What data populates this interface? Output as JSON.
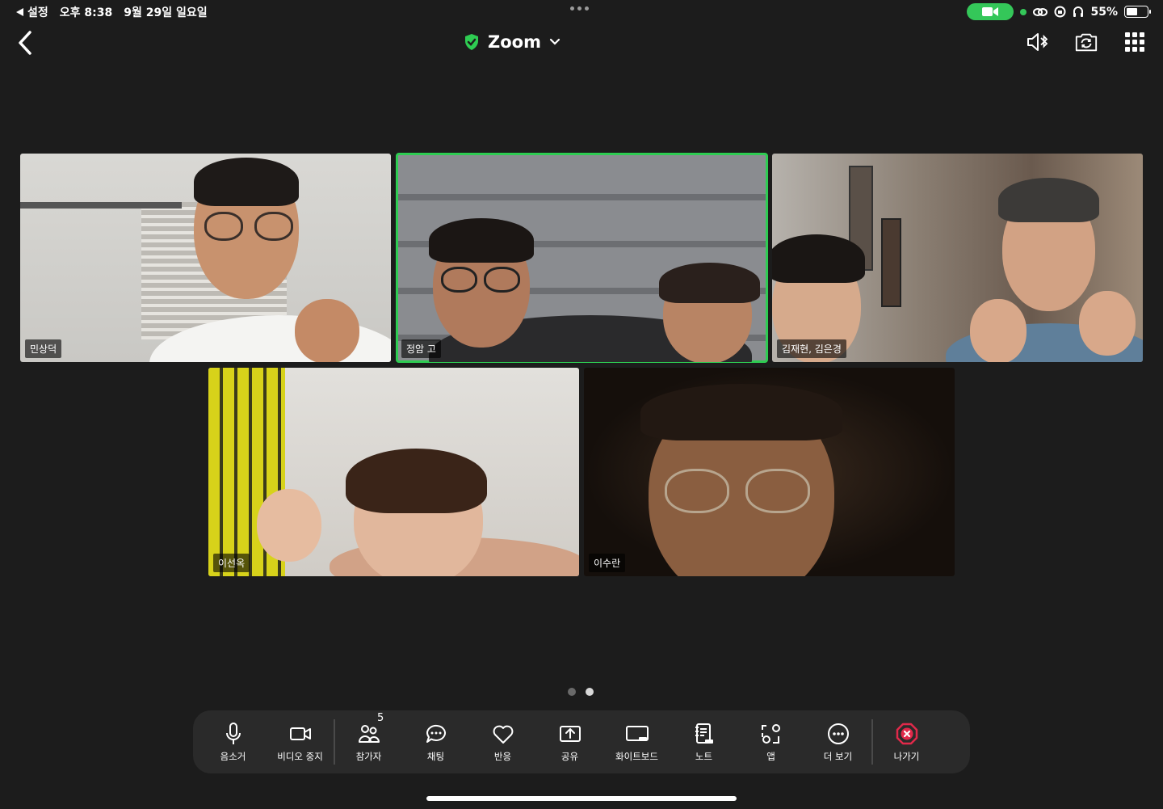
{
  "status_bar": {
    "back_app": "설정",
    "time": "오후 8:38",
    "date": "9월 29일 일요일",
    "battery": "55%",
    "battery_level": 0.55
  },
  "header": {
    "title": "Zoom"
  },
  "participants": [
    {
      "name": "민상덕"
    },
    {
      "name": "정암 고"
    },
    {
      "name": "김재현, 김은경"
    },
    {
      "name": "이선옥"
    },
    {
      "name": "이수란"
    }
  ],
  "pager": {
    "pages": 2,
    "current": 2
  },
  "toolbar": {
    "mute": "음소거",
    "video": "비디오 중지",
    "participants": "참가자",
    "participants_count": "5",
    "chat": "채팅",
    "reactions": "반응",
    "share": "공유",
    "whiteboard": "화이트보드",
    "notes": "노트",
    "apps": "앱",
    "more": "더 보기",
    "leave": "나가기"
  },
  "colors": {
    "background": "#1c1c1c",
    "active_speaker": "#2ecc52",
    "leave": "#e0294a",
    "toolbar": "#2a2a2a"
  }
}
